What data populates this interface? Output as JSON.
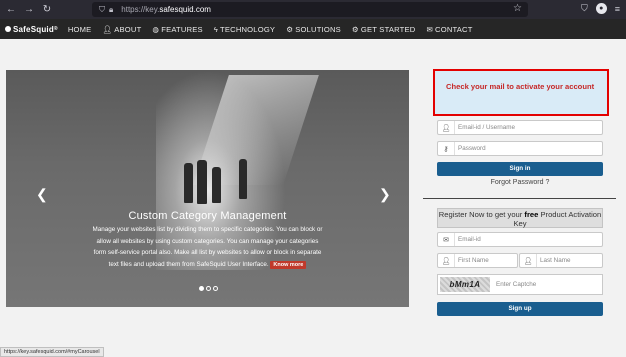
{
  "browser": {
    "url_host": "https://key.",
    "url_domain": "safesquid.com",
    "status_link": "https://key.safesquid.com/#myCarousel"
  },
  "site": {
    "logo": "SafeSquid",
    "nav": [
      {
        "label": "HOME",
        "icon": ""
      },
      {
        "label": "ABOUT",
        "icon": "user-icon"
      },
      {
        "label": "FEATURES",
        "icon": "globe-icon"
      },
      {
        "label": "TECHNOLOGY",
        "icon": "bolt-icon"
      },
      {
        "label": "SOLUTIONS",
        "icon": "cogs-icon"
      },
      {
        "label": "GET STARTED",
        "icon": "cogs-icon"
      },
      {
        "label": "CONTACT",
        "icon": "envelope-icon"
      }
    ]
  },
  "carousel": {
    "title": "Custom Category Management",
    "body": "Manage your websites list by dividing them to specific categories. You can block or allow all websites by using custom categories. You can manage your categories form self-service portal also. Make all list by websites to allow or block in separate text files and upload them from SafeSquid User Interface.",
    "know_more": "Know more"
  },
  "login": {
    "alert": "Check your mail to activate your account",
    "email_placeholder": "Email-id / Username",
    "password_placeholder": "Password",
    "signin_label": "Sign in",
    "forgot_label": "Forgot Password ?"
  },
  "register": {
    "heading_pre": "Register Now to get your ",
    "heading_bold": "free",
    "heading_post": " Product Activation Key",
    "email_placeholder": "Email-id",
    "first_name_placeholder": "First Name",
    "last_name_placeholder": "Last Name",
    "captcha_text": "bMm1A",
    "captcha_placeholder": "Enter Captche",
    "signup_label": "Sign up"
  },
  "colors": {
    "alert_border": "#e30000",
    "alert_bg": "#d9ebf7",
    "button": "#1a5e8f",
    "nav_bg": "#262626"
  }
}
